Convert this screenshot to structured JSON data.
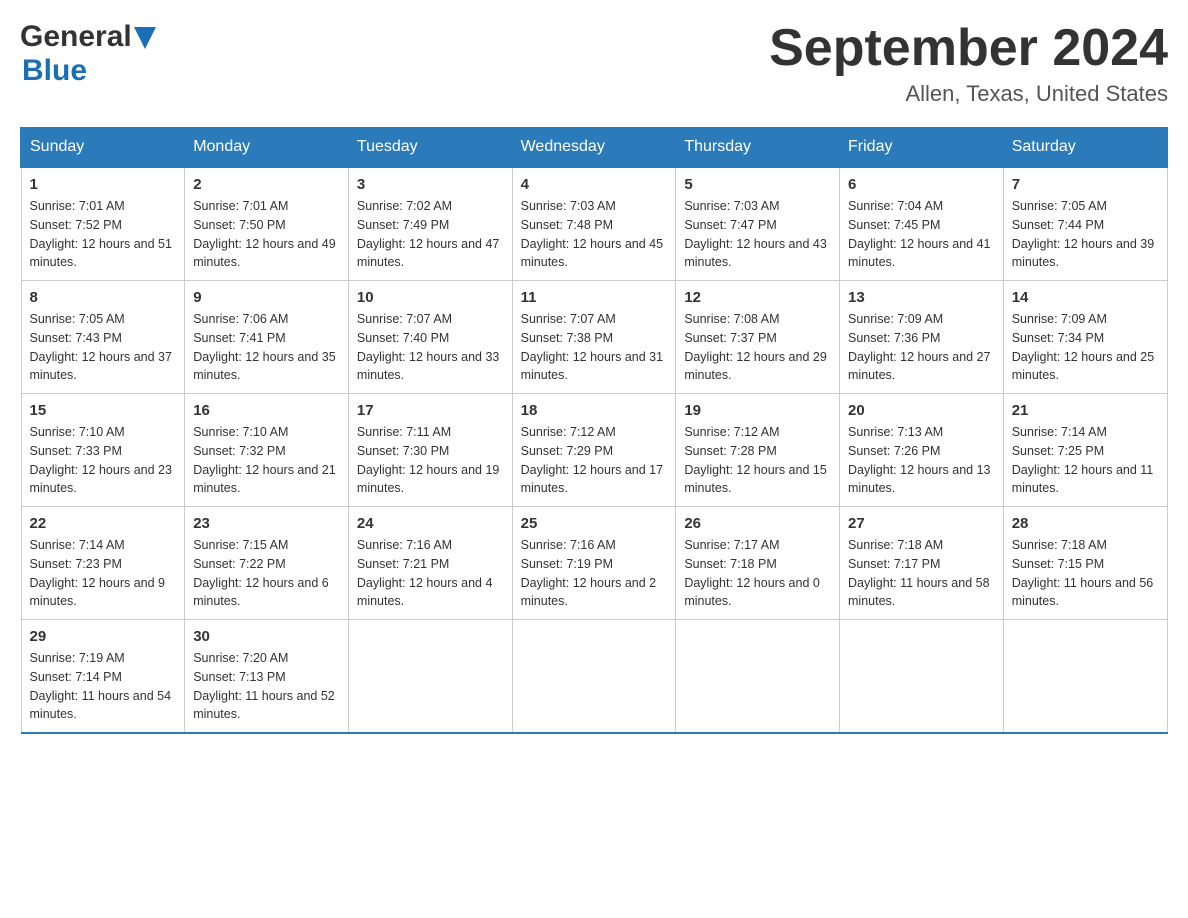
{
  "header": {
    "logo_general": "General",
    "logo_blue": "Blue",
    "month_year": "September 2024",
    "location": "Allen, Texas, United States"
  },
  "weekdays": [
    "Sunday",
    "Monday",
    "Tuesday",
    "Wednesday",
    "Thursday",
    "Friday",
    "Saturday"
  ],
  "weeks": [
    [
      {
        "day": "1",
        "sunrise": "7:01 AM",
        "sunset": "7:52 PM",
        "daylight": "12 hours and 51 minutes."
      },
      {
        "day": "2",
        "sunrise": "7:01 AM",
        "sunset": "7:50 PM",
        "daylight": "12 hours and 49 minutes."
      },
      {
        "day": "3",
        "sunrise": "7:02 AM",
        "sunset": "7:49 PM",
        "daylight": "12 hours and 47 minutes."
      },
      {
        "day": "4",
        "sunrise": "7:03 AM",
        "sunset": "7:48 PM",
        "daylight": "12 hours and 45 minutes."
      },
      {
        "day": "5",
        "sunrise": "7:03 AM",
        "sunset": "7:47 PM",
        "daylight": "12 hours and 43 minutes."
      },
      {
        "day": "6",
        "sunrise": "7:04 AM",
        "sunset": "7:45 PM",
        "daylight": "12 hours and 41 minutes."
      },
      {
        "day": "7",
        "sunrise": "7:05 AM",
        "sunset": "7:44 PM",
        "daylight": "12 hours and 39 minutes."
      }
    ],
    [
      {
        "day": "8",
        "sunrise": "7:05 AM",
        "sunset": "7:43 PM",
        "daylight": "12 hours and 37 minutes."
      },
      {
        "day": "9",
        "sunrise": "7:06 AM",
        "sunset": "7:41 PM",
        "daylight": "12 hours and 35 minutes."
      },
      {
        "day": "10",
        "sunrise": "7:07 AM",
        "sunset": "7:40 PM",
        "daylight": "12 hours and 33 minutes."
      },
      {
        "day": "11",
        "sunrise": "7:07 AM",
        "sunset": "7:38 PM",
        "daylight": "12 hours and 31 minutes."
      },
      {
        "day": "12",
        "sunrise": "7:08 AM",
        "sunset": "7:37 PM",
        "daylight": "12 hours and 29 minutes."
      },
      {
        "day": "13",
        "sunrise": "7:09 AM",
        "sunset": "7:36 PM",
        "daylight": "12 hours and 27 minutes."
      },
      {
        "day": "14",
        "sunrise": "7:09 AM",
        "sunset": "7:34 PM",
        "daylight": "12 hours and 25 minutes."
      }
    ],
    [
      {
        "day": "15",
        "sunrise": "7:10 AM",
        "sunset": "7:33 PM",
        "daylight": "12 hours and 23 minutes."
      },
      {
        "day": "16",
        "sunrise": "7:10 AM",
        "sunset": "7:32 PM",
        "daylight": "12 hours and 21 minutes."
      },
      {
        "day": "17",
        "sunrise": "7:11 AM",
        "sunset": "7:30 PM",
        "daylight": "12 hours and 19 minutes."
      },
      {
        "day": "18",
        "sunrise": "7:12 AM",
        "sunset": "7:29 PM",
        "daylight": "12 hours and 17 minutes."
      },
      {
        "day": "19",
        "sunrise": "7:12 AM",
        "sunset": "7:28 PM",
        "daylight": "12 hours and 15 minutes."
      },
      {
        "day": "20",
        "sunrise": "7:13 AM",
        "sunset": "7:26 PM",
        "daylight": "12 hours and 13 minutes."
      },
      {
        "day": "21",
        "sunrise": "7:14 AM",
        "sunset": "7:25 PM",
        "daylight": "12 hours and 11 minutes."
      }
    ],
    [
      {
        "day": "22",
        "sunrise": "7:14 AM",
        "sunset": "7:23 PM",
        "daylight": "12 hours and 9 minutes."
      },
      {
        "day": "23",
        "sunrise": "7:15 AM",
        "sunset": "7:22 PM",
        "daylight": "12 hours and 6 minutes."
      },
      {
        "day": "24",
        "sunrise": "7:16 AM",
        "sunset": "7:21 PM",
        "daylight": "12 hours and 4 minutes."
      },
      {
        "day": "25",
        "sunrise": "7:16 AM",
        "sunset": "7:19 PM",
        "daylight": "12 hours and 2 minutes."
      },
      {
        "day": "26",
        "sunrise": "7:17 AM",
        "sunset": "7:18 PM",
        "daylight": "12 hours and 0 minutes."
      },
      {
        "day": "27",
        "sunrise": "7:18 AM",
        "sunset": "7:17 PM",
        "daylight": "11 hours and 58 minutes."
      },
      {
        "day": "28",
        "sunrise": "7:18 AM",
        "sunset": "7:15 PM",
        "daylight": "11 hours and 56 minutes."
      }
    ],
    [
      {
        "day": "29",
        "sunrise": "7:19 AM",
        "sunset": "7:14 PM",
        "daylight": "11 hours and 54 minutes."
      },
      {
        "day": "30",
        "sunrise": "7:20 AM",
        "sunset": "7:13 PM",
        "daylight": "11 hours and 52 minutes."
      },
      null,
      null,
      null,
      null,
      null
    ]
  ],
  "labels": {
    "sunrise": "Sunrise:",
    "sunset": "Sunset:",
    "daylight": "Daylight:"
  }
}
